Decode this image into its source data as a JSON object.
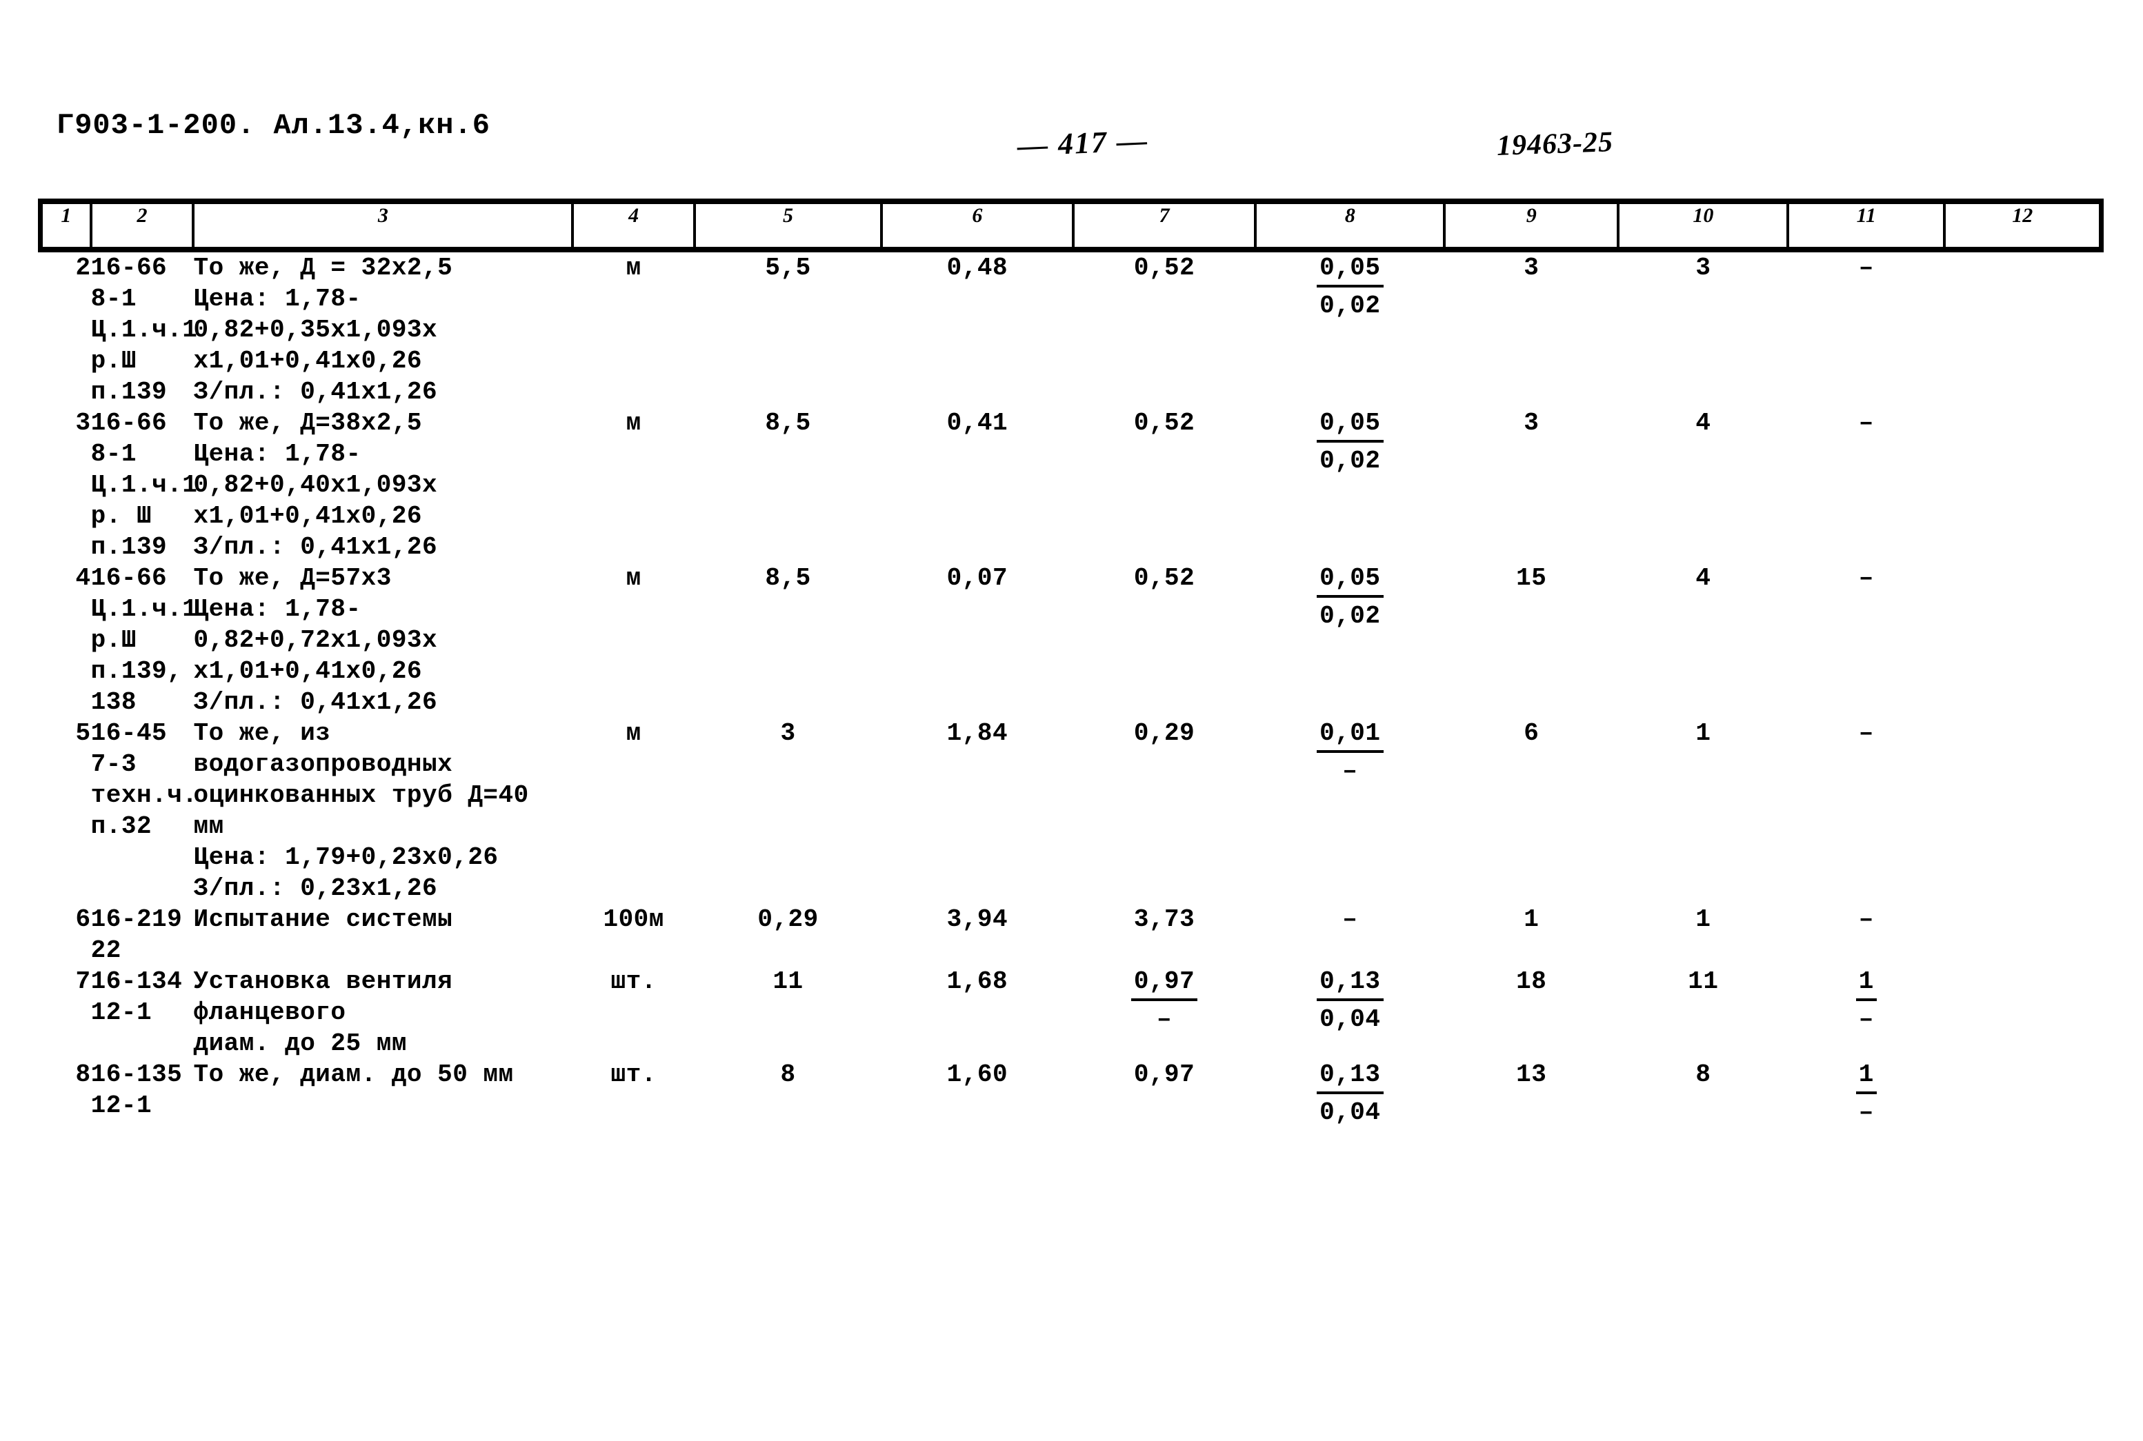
{
  "header": {
    "doc_code": "Г903-1-200. Ал.13.4,кн.6",
    "page_number": "— 417 —",
    "stamp_number": "19463-25"
  },
  "table": {
    "column_numbers": [
      "1",
      "2",
      "3",
      "4",
      "5",
      "6",
      "7",
      "8",
      "9",
      "10",
      "11",
      "12"
    ],
    "rows": [
      {
        "c1": "2",
        "c2": "16-66\n8-1\nЦ.1.ч.1\nр.Ш\nп.139",
        "c3": "То же, Д = 32х2,5\nЦена: 1,78-0,82+0,35х1,093х\nх1,01+0,41х0,26\nЗ/пл.: 0,41х1,26",
        "c4": "м",
        "c5": "5,5",
        "c6": "0,48",
        "c7": "0,52",
        "c8_num": "0,05",
        "c8_den": "0,02",
        "c9": "3",
        "c10": "3",
        "c11": "–",
        "c12": ""
      },
      {
        "c1": "3",
        "c2": "16-66\n8-1\nЦ.1.ч.1\nр. Ш\nп.139",
        "c3": "То же, Д=38х2,5\nЦена: 1,78-0,82+0,40х1,093х\nх1,01+0,41х0,26\nЗ/пл.: 0,41х1,26",
        "c4": "м",
        "c5": "8,5",
        "c6": "0,41",
        "c7": "0,52",
        "c8_num": "0,05",
        "c8_den": "0,02",
        "c9": "3",
        "c10": "4",
        "c11": "–",
        "c12": ""
      },
      {
        "c1": "4",
        "c2": "16-66\nЦ.1.ч.1\nр.Ш\nп.139,\n138",
        "c3": "То же, Д=57х3\nЦена: 1,78-0,82+0,72х1,093х\nх1,01+0,41х0,26\nЗ/пл.: 0,41х1,26",
        "c4": "м",
        "c5": "8,5",
        "c6": "0,07",
        "c7": "0,52",
        "c8_num": "0,05",
        "c8_den": "0,02",
        "c9": "15",
        "c10": "4",
        "c11": "–",
        "c12": ""
      },
      {
        "c1": "5",
        "c2": "16-45\n7-3\nтехн.ч.\nп.32",
        "c3": "То же, из водогазопроводных\nоцинкованных труб Д=40 мм\nЦена: 1,79+0,23х0,26\nЗ/пл.: 0,23х1,26",
        "c4": "м",
        "c5": "3",
        "c6": "1,84",
        "c7": "0,29",
        "c8_num": "0,01",
        "c8_den": "–",
        "c9": "6",
        "c10": "1",
        "c11": "–",
        "c12": ""
      },
      {
        "c1": "6",
        "c2": "16-219\n22",
        "c3": "Испытание системы",
        "c4": "100м",
        "c5": "0,29",
        "c6": "3,94",
        "c7": "3,73",
        "c8": "–",
        "c9": "1",
        "c10": "1",
        "c11": "–",
        "c12": ""
      },
      {
        "c1": "7",
        "c2": "16-134\n12-1",
        "c3": "Установка вентиля фланцевого\nдиам. до 25 мм",
        "c4": "шт.",
        "c5": "11",
        "c6": "1,68",
        "c7_num": "0,97",
        "c7_den": "–",
        "c8_num": "0,13",
        "c8_den": "0,04",
        "c9": "18",
        "c10": "11",
        "c11_num": "1",
        "c11_den": "–",
        "c12": ""
      },
      {
        "c1": "8",
        "c2": "16-135\n12-1",
        "c3": "То же, диам. до 50 мм",
        "c4": "шт.",
        "c5": "8",
        "c6": "1,60",
        "c7": "0,97",
        "c8_num": "0,13",
        "c8_den": "0,04",
        "c9": "13",
        "c10": "8",
        "c11_num": "1",
        "c11_den": "–",
        "c12": ""
      }
    ]
  }
}
